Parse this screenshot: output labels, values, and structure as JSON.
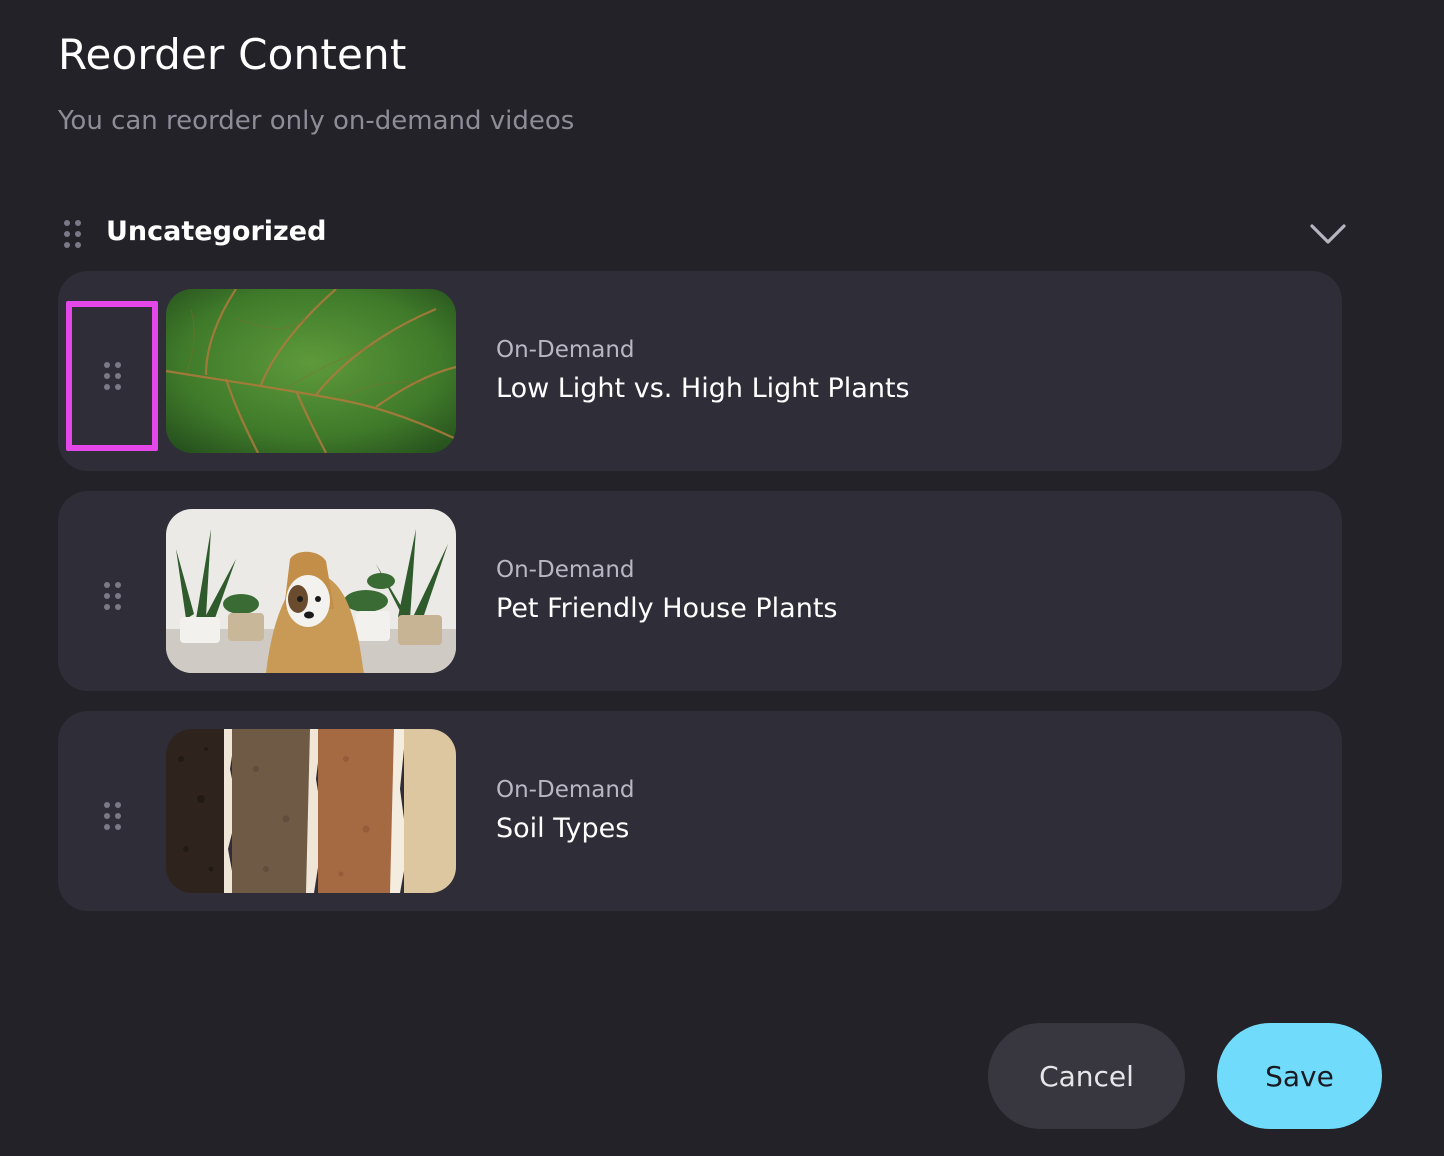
{
  "header": {
    "title": "Reorder Content",
    "subtitle": "You can reorder only on-demand videos"
  },
  "category": {
    "name": "Uncategorized",
    "expanded": true,
    "icons": {
      "drag": "drag-handle-icon",
      "toggle": "chevron-down-icon"
    }
  },
  "videos": [
    {
      "type": "On-Demand",
      "title": "Low Light vs. High Light Plants",
      "thumbnail": "leaf-thumbnail",
      "focused": true
    },
    {
      "type": "On-Demand",
      "title": "Pet Friendly House Plants",
      "thumbnail": "dog-plants-thumbnail",
      "focused": false
    },
    {
      "type": "On-Demand",
      "title": "Soil Types",
      "thumbnail": "soil-thumbnail",
      "focused": false
    }
  ],
  "actions": {
    "cancel_label": "Cancel",
    "save_label": "Save"
  },
  "colors": {
    "background": "#232228",
    "card": "#2f2e38",
    "accent": "#70dbfa",
    "focus_ring": "#e548e8",
    "muted_text": "#8e8c97"
  }
}
